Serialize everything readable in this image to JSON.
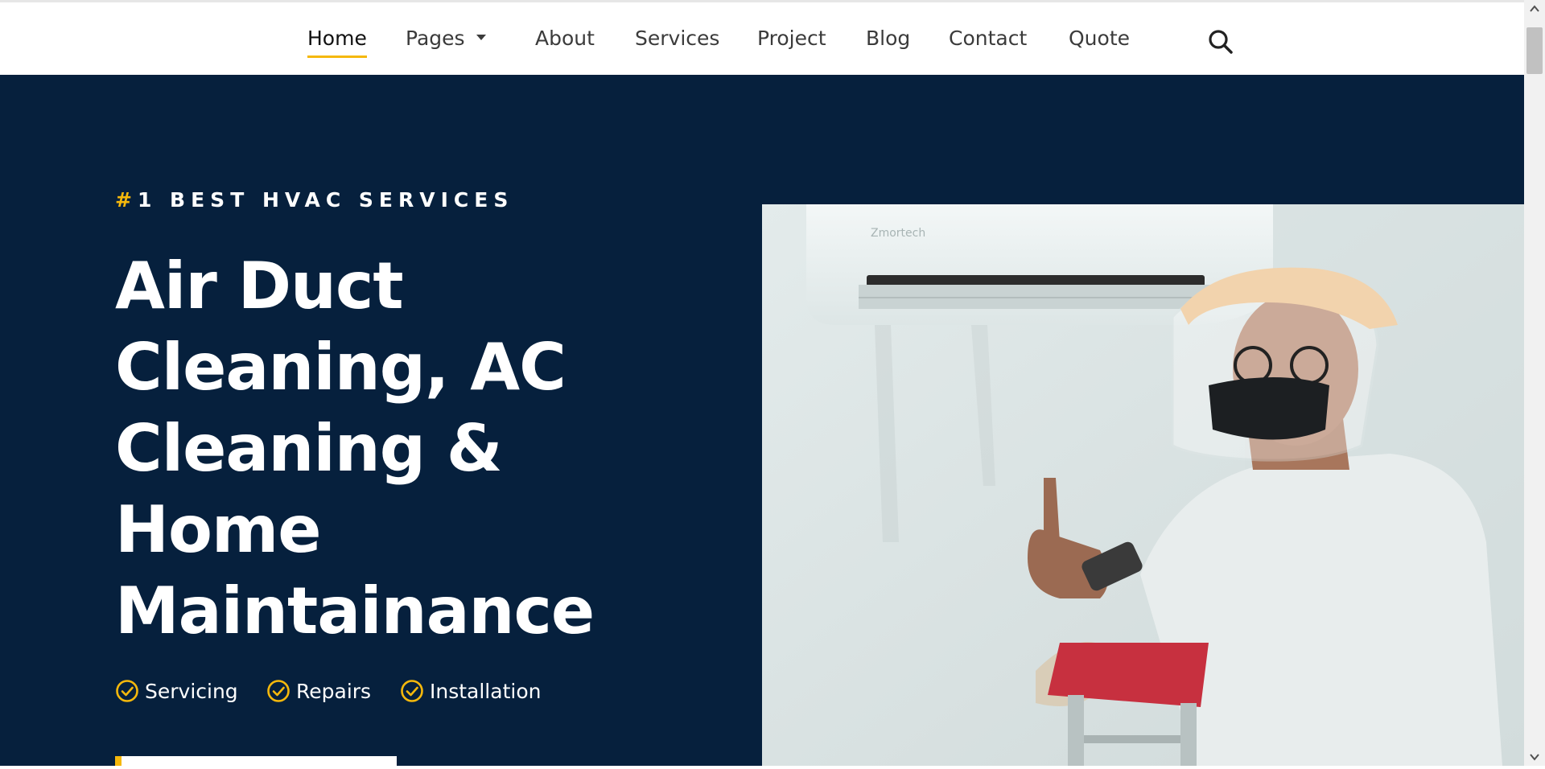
{
  "nav": {
    "items": [
      {
        "label": "Home",
        "active": true
      },
      {
        "label": "Pages",
        "dropdown": true
      },
      {
        "label": "About"
      },
      {
        "label": "Services"
      },
      {
        "label": "Project"
      },
      {
        "label": "Blog"
      },
      {
        "label": "Contact"
      },
      {
        "label": "Quote"
      }
    ],
    "search_icon": "search-icon"
  },
  "hero": {
    "tagline_hash": "#",
    "tagline_text": "1 BEST HVAC SERVICES",
    "title_lines": [
      "Air Duct",
      "Cleaning, AC",
      "Cleaning &",
      "Home",
      "Maintainance"
    ],
    "features": [
      {
        "label": "Servicing",
        "icon": "check-circle-icon"
      },
      {
        "label": "Repairs",
        "icon": "check-circle-icon"
      },
      {
        "label": "Installation",
        "icon": "check-circle-icon"
      }
    ],
    "image": "hvac-technician-photo"
  },
  "colors": {
    "hero_bg": "#06203d",
    "accent": "#f5b80c",
    "nav_text": "#3b3b3b",
    "white": "#ffffff"
  }
}
